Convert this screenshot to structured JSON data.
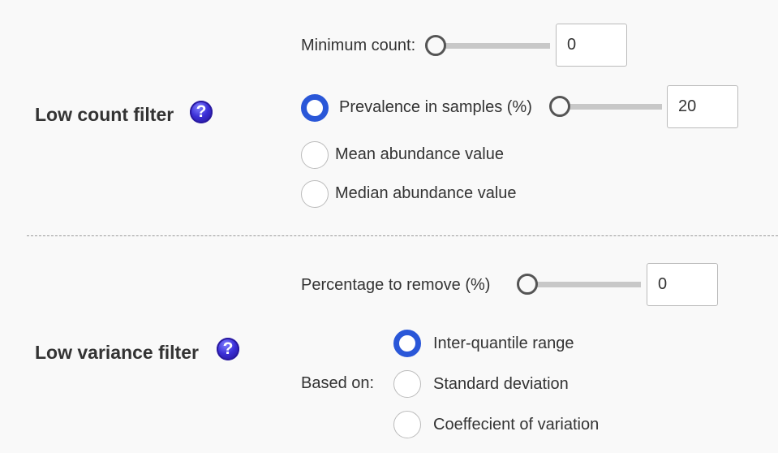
{
  "low_count": {
    "title": "Low count filter",
    "help_icon": "question-icon",
    "min_count": {
      "label": "Minimum count:",
      "slider_value": 0,
      "input_value": "0"
    },
    "prevalence": {
      "label": "Prevalence in samples (%)",
      "slider_value": 0,
      "input_value": "20",
      "selected": true
    },
    "options": [
      {
        "label": "Prevalence in samples (%)",
        "selected": true
      },
      {
        "label": "Mean abundance value",
        "selected": false
      },
      {
        "label": "Median abundance value",
        "selected": false
      }
    ]
  },
  "low_variance": {
    "title": "Low variance filter",
    "help_icon": "question-icon",
    "percentage": {
      "label": "Percentage to remove (%)",
      "slider_value": 0,
      "input_value": "0"
    },
    "based_on_label": "Based on:",
    "options": [
      {
        "label": "Inter-quantile range",
        "selected": true
      },
      {
        "label": "Standard deviation",
        "selected": false
      },
      {
        "label": "Coeffecient of variation",
        "selected": false
      }
    ]
  },
  "colors": {
    "accent": "#2a57d8",
    "help_icon": "#3b2fd6",
    "text": "#333333",
    "background": "#f9f9f9"
  }
}
